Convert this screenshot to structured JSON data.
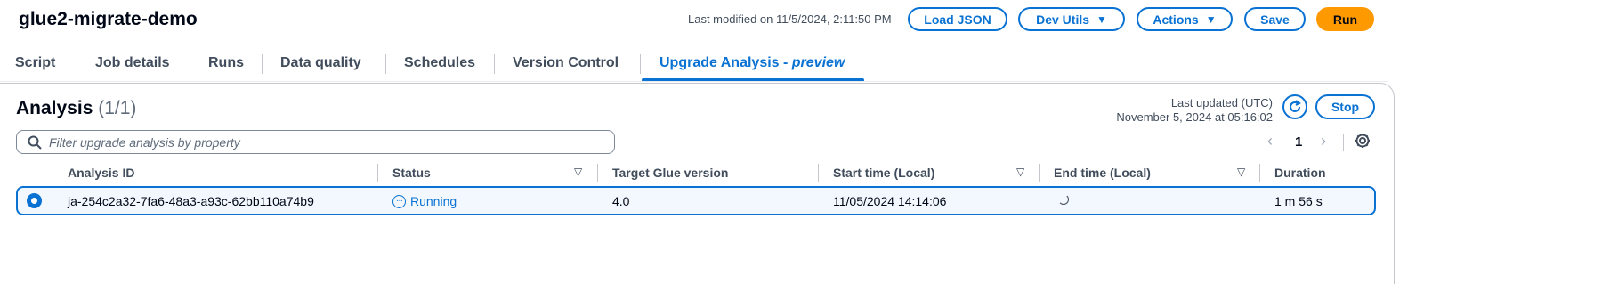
{
  "header": {
    "title": "glue2-migrate-demo",
    "last_modified": "Last modified on 11/5/2024, 2:11:50 PM",
    "load_json": "Load JSON",
    "dev_utils": "Dev Utils",
    "actions": "Actions",
    "save": "Save",
    "run": "Run"
  },
  "tabs": {
    "script": "Script",
    "job_details": "Job details",
    "runs": "Runs",
    "data_quality": "Data quality",
    "schedules": "Schedules",
    "version_control": "Version Control",
    "upgrade_analysis": "Upgrade Analysis - ",
    "upgrade_analysis_suffix": "preview"
  },
  "analysis": {
    "title": "Analysis",
    "count": "(1/1)",
    "last_updated_label": "Last updated (UTC)",
    "last_updated_value": "November 5, 2024 at 05:16:02",
    "stop": "Stop",
    "filter_placeholder": "Filter upgrade analysis by property",
    "page": "1"
  },
  "table": {
    "columns": {
      "analysis_id": "Analysis ID",
      "status": "Status",
      "target_glue_version": "Target Glue version",
      "start_time": "Start time (Local)",
      "end_time": "End time (Local)",
      "duration": "Duration"
    },
    "rows": [
      {
        "analysis_id": "ja-254c2a32-7fa6-48a3-a93c-62bb110a74b9",
        "status": "Running",
        "target_glue_version": "4.0",
        "start_time": "11/05/2024 14:14:06",
        "end_time": "",
        "duration": "1 m 56 s"
      }
    ]
  },
  "colors": {
    "accent": "#0972d3",
    "run_button": "#ff9900"
  }
}
